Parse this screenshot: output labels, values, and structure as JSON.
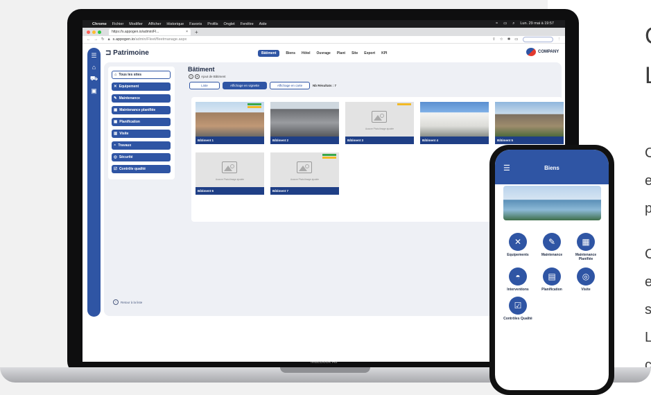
{
  "side_text": [
    "C",
    "L",
    "C",
    "e",
    "p",
    "C",
    "e",
    "s",
    "L",
    "c"
  ],
  "laptop": {
    "model": "MacBook Air"
  },
  "menubar": {
    "items": [
      "Chrome",
      "Fichier",
      "Modifier",
      "Afficher",
      "Historique",
      "Favoris",
      "Profils",
      "Onglet",
      "Fenêtre",
      "Aide"
    ],
    "datetime": "Lun. 29 mai à 19:57"
  },
  "browser": {
    "tab_title": "https://s.appogen.io/admin/Fl...",
    "url_domain": "s.appogen.io",
    "url_path": "/admin/Fleet/fleetmanage.aspx"
  },
  "app": {
    "title": "Patrimoine",
    "nav": [
      "Bâtiment",
      "Biens",
      "Hôtel",
      "Ouvrage",
      "Plant",
      "Site",
      "Export",
      "KPI"
    ],
    "logo_text": "COMPANY",
    "sidebar": [
      {
        "label": "Tous les sites",
        "icon": "home"
      },
      {
        "label": "Equipement",
        "icon": "tools"
      },
      {
        "label": "Maintenance",
        "icon": "wrench"
      },
      {
        "label": "Maintenance planifiée",
        "icon": "calendar"
      },
      {
        "label": "Planification",
        "icon": "calendar"
      },
      {
        "label": "Visite",
        "icon": "building"
      },
      {
        "label": "Travaux",
        "icon": "hardhat"
      },
      {
        "label": "Sécurité",
        "icon": "shield"
      },
      {
        "label": "Contrôle qualité",
        "icon": "check"
      }
    ],
    "back_label": "Retour à la liste",
    "content_title": "Bâtiment",
    "add_label": "Ajout de Bâtiment",
    "view_buttons": [
      "Liste",
      "Affichage en vignette",
      "Affichage en carte"
    ],
    "results": "Nb Résultats : 7",
    "placeholder_text": "Aucune Photo/Image ajoutée",
    "cards": [
      {
        "label": "Bâtiment 1",
        "photo": "b1",
        "badges": true
      },
      {
        "label": "Bâtiment 2",
        "photo": "b2",
        "badges": false
      },
      {
        "label": "Bâtiment 3",
        "photo": "ph",
        "badges": true
      },
      {
        "label": "Bâtiment 4",
        "photo": "b4",
        "badges": false
      },
      {
        "label": "Bâtiment 5",
        "photo": "b5",
        "badges": false
      },
      {
        "label": "Bâtiment 6",
        "photo": "ph",
        "badges": false
      },
      {
        "label": "Bâtiment 7",
        "photo": "ph",
        "badges": true
      }
    ]
  },
  "phone": {
    "title": "Biens",
    "items": [
      {
        "label": "Equipements",
        "icon": "tools-icon"
      },
      {
        "label": "Maintenance",
        "icon": "wrench-icon"
      },
      {
        "label": "Maintenance Planifiée",
        "icon": "calendar-icon"
      },
      {
        "label": "Interventions",
        "icon": "hardhat-icon"
      },
      {
        "label": "Planification",
        "icon": "clipboard-icon"
      },
      {
        "label": "Visite",
        "icon": "visit-icon"
      },
      {
        "label": "Contrôles Qualité",
        "icon": "quality-icon"
      }
    ]
  },
  "colors": {
    "primary": "#2f55a4",
    "navy": "#1f3f86",
    "badge_green": "#39a84a",
    "badge_yellow": "#f2b925"
  }
}
